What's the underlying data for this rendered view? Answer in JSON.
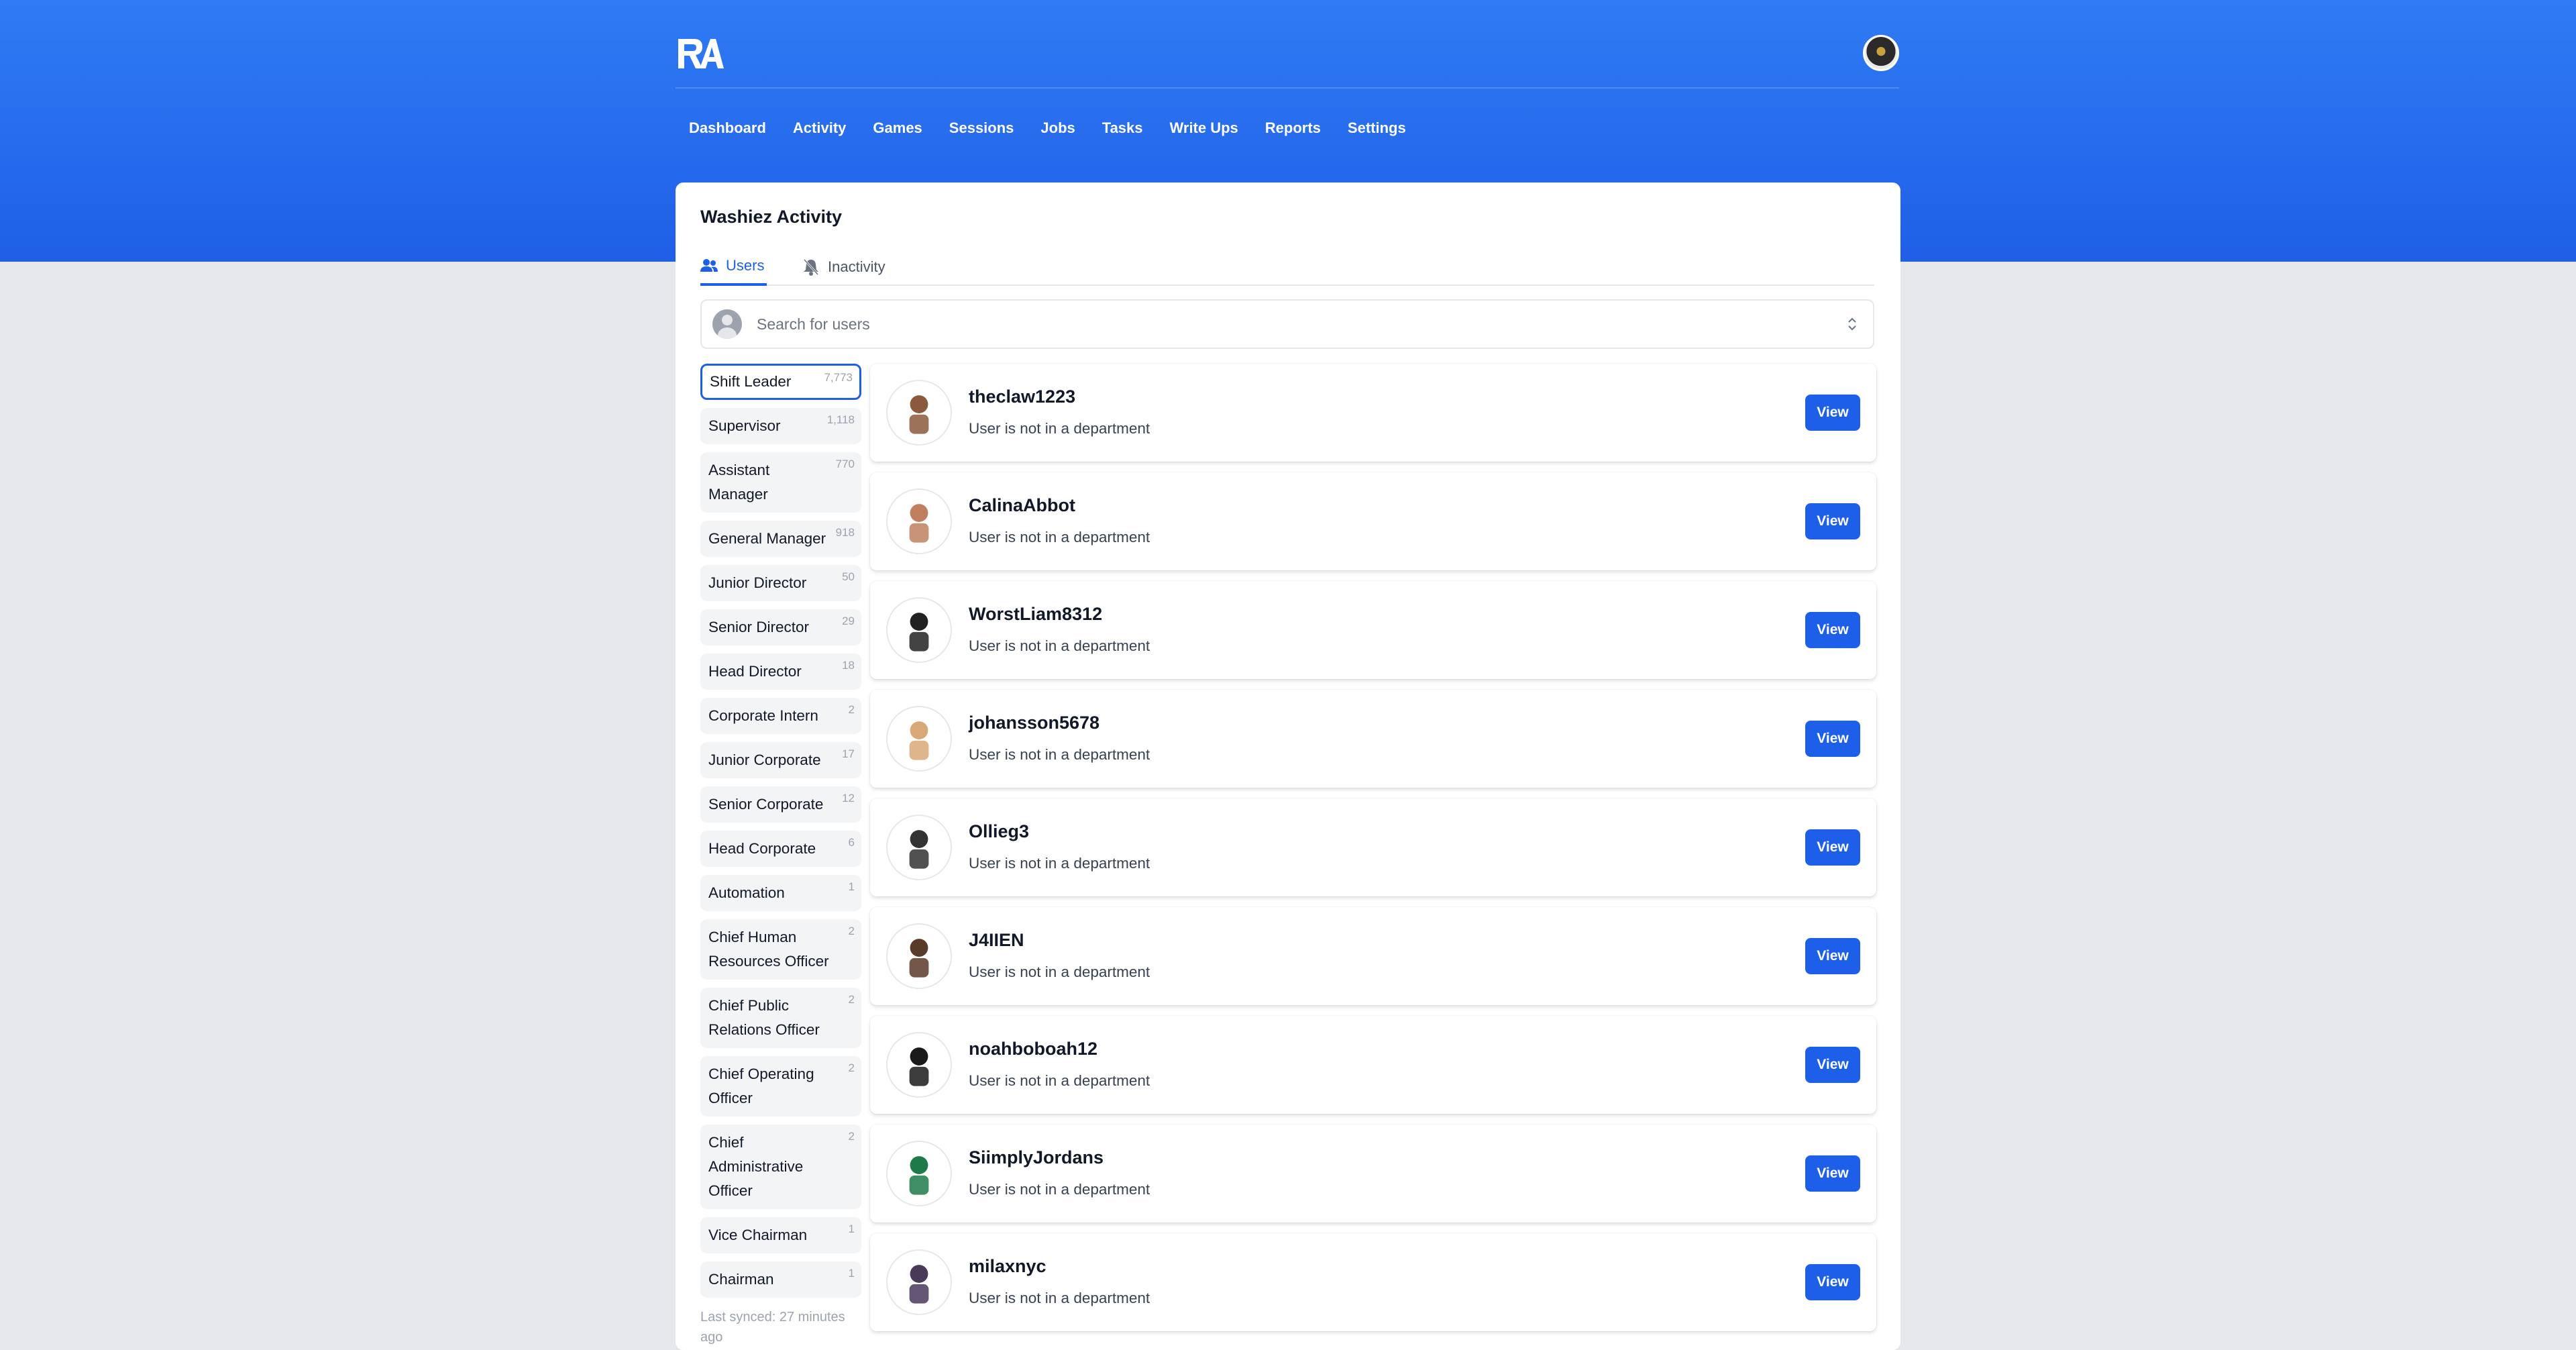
{
  "header": {
    "logo_text": "RA",
    "nav": [
      "Dashboard",
      "Activity",
      "Games",
      "Sessions",
      "Jobs",
      "Tasks",
      "Write Ups",
      "Reports",
      "Settings"
    ]
  },
  "card": {
    "title": "Washiez Activity",
    "tabs": [
      {
        "label": "Users",
        "icon": "users-icon",
        "active": true
      },
      {
        "label": "Inactivity",
        "icon": "bell-slash-icon",
        "active": false
      }
    ],
    "search_placeholder": "Search for users"
  },
  "roles": [
    {
      "label": "Shift Leader",
      "count": "7,773",
      "active": true
    },
    {
      "label": "Supervisor",
      "count": "1,118"
    },
    {
      "label": "Assistant Manager",
      "count": "770"
    },
    {
      "label": "General Manager",
      "count": "918"
    },
    {
      "label": "Junior Director",
      "count": "50"
    },
    {
      "label": "Senior Director",
      "count": "29"
    },
    {
      "label": "Head Director",
      "count": "18"
    },
    {
      "label": "Corporate Intern",
      "count": "2"
    },
    {
      "label": "Junior Corporate",
      "count": "17"
    },
    {
      "label": "Senior Corporate",
      "count": "12"
    },
    {
      "label": "Head Corporate",
      "count": "6"
    },
    {
      "label": "Automation",
      "count": "1"
    },
    {
      "label": "Chief Human Resources Officer",
      "count": "2"
    },
    {
      "label": "Chief Public Relations Officer",
      "count": "2"
    },
    {
      "label": "Chief Operating Officer",
      "count": "2"
    },
    {
      "label": "Chief Administrative Officer",
      "count": "2"
    },
    {
      "label": "Vice Chairman",
      "count": "1"
    },
    {
      "label": "Chairman",
      "count": "1"
    }
  ],
  "last_synced": "Last synced: 27 minutes ago",
  "users": [
    {
      "name": "theclaw1223",
      "department": "User is not in a department",
      "action": "View",
      "avatar_color": "#8b5a3c"
    },
    {
      "name": "CalinaAbbot",
      "department": "User is not in a department",
      "action": "View",
      "avatar_color": "#c08060"
    },
    {
      "name": "WorstLiam8312",
      "department": "User is not in a department",
      "action": "View",
      "avatar_color": "#222222"
    },
    {
      "name": "johansson5678",
      "department": "User is not in a department",
      "action": "View",
      "avatar_color": "#d9a878"
    },
    {
      "name": "Ollieg3",
      "department": "User is not in a department",
      "action": "View",
      "avatar_color": "#333333"
    },
    {
      "name": "J4IIEN",
      "department": "User is not in a department",
      "action": "View",
      "avatar_color": "#5a3b2a"
    },
    {
      "name": "noahboboah12",
      "department": "User is not in a department",
      "action": "View",
      "avatar_color": "#1a1a1a"
    },
    {
      "name": "SiimplyJordans",
      "department": "User is not in a department",
      "action": "View",
      "avatar_color": "#1f7a4a"
    },
    {
      "name": "milaxnyc",
      "department": "User is not in a department",
      "action": "View",
      "avatar_color": "#4a3a5a"
    }
  ]
}
